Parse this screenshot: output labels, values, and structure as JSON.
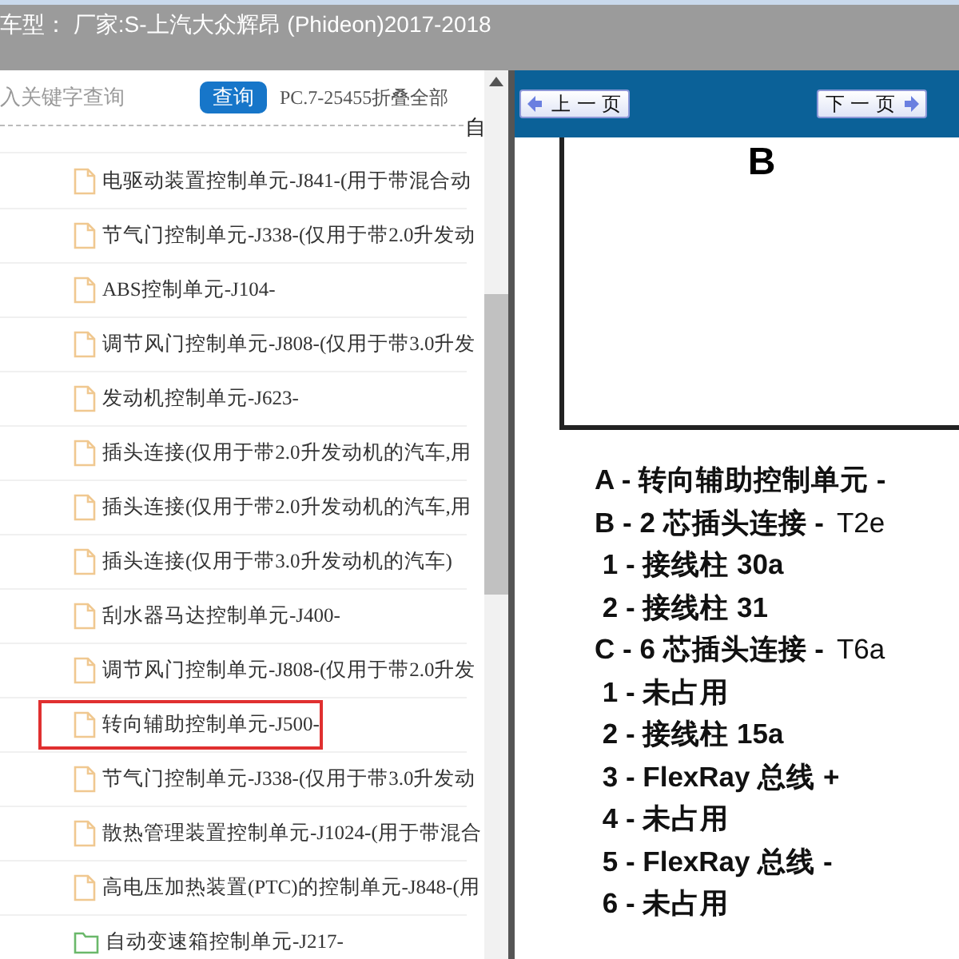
{
  "header": {
    "title": "车型： 厂家:S-上汽大众辉昂 (Phideon)2017-2018"
  },
  "search": {
    "placeholder": "入关键字查询",
    "button": "查询",
    "info": "PC.7-25455折叠全部",
    "fragment": "自"
  },
  "tree": {
    "items": [
      {
        "kind": "file",
        "label": "电驱动装置控制单元-J841-(用于带混合动",
        "selected": false
      },
      {
        "kind": "file",
        "label": "节气门控制单元-J338-(仅用于带2.0升发动",
        "selected": false
      },
      {
        "kind": "file",
        "label": "ABS控制单元-J104-",
        "selected": false
      },
      {
        "kind": "file",
        "label": "调节风门控制单元-J808-(仅用于带3.0升发",
        "selected": false
      },
      {
        "kind": "file",
        "label": "发动机控制单元-J623-",
        "selected": false
      },
      {
        "kind": "file",
        "label": "插头连接(仅用于带2.0升发动机的汽车,用",
        "selected": false
      },
      {
        "kind": "file",
        "label": "插头连接(仅用于带2.0升发动机的汽车,用",
        "selected": false
      },
      {
        "kind": "file",
        "label": "插头连接(仅用于带3.0升发动机的汽车)",
        "selected": false
      },
      {
        "kind": "file",
        "label": "刮水器马达控制单元-J400-",
        "selected": false
      },
      {
        "kind": "file",
        "label": "调节风门控制单元-J808-(仅用于带2.0升发",
        "selected": false
      },
      {
        "kind": "file",
        "label": "转向辅助控制单元-J500-",
        "selected": true
      },
      {
        "kind": "file",
        "label": "节气门控制单元-J338-(仅用于带3.0升发动",
        "selected": false
      },
      {
        "kind": "file",
        "label": "散热管理装置控制单元-J1024-(用于带混合",
        "selected": false
      },
      {
        "kind": "file",
        "label": "高电压加热装置(PTC)的控制单元-J848-(用",
        "selected": false
      },
      {
        "kind": "folder",
        "label": "自动变速箱控制单元-J217-",
        "selected": false
      }
    ]
  },
  "viewer": {
    "prev_button": "上 一 页",
    "next_button": "下 一 页",
    "diagram_letter": "B",
    "legend": [
      {
        "label": "A - 转向辅助控制单元 -"
      },
      {
        "label": "B - 2 芯插头连接 -",
        "code": "T2e"
      },
      {
        "label": " 1 - 接线柱 30a"
      },
      {
        "label": " 2 - 接线柱 31"
      },
      {
        "label": "C - 6 芯插头连接 -",
        "code": "T6a"
      },
      {
        "label": " 1 - 未占用"
      },
      {
        "label": " 2 - 接线柱 15a"
      },
      {
        "label": " 3 - FlexRay 总线 +"
      },
      {
        "label": " 4 - 未占用"
      },
      {
        "label": " 5 - FlexRay 总线 -"
      },
      {
        "label": " 6 - 未占用"
      }
    ]
  }
}
